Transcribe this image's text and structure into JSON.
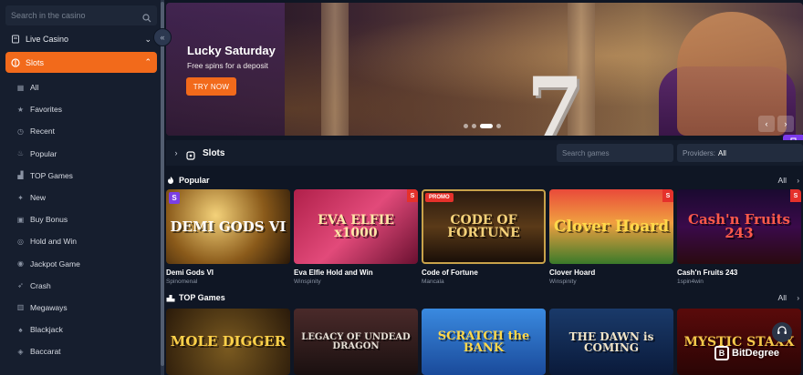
{
  "sidebar": {
    "search_placeholder": "Search in the casino",
    "categories": [
      {
        "label": "Live Casino",
        "icon": "live-casino-icon",
        "chevron": "⌄"
      },
      {
        "label": "Slots",
        "icon": "slots-icon",
        "chevron": "⌃",
        "active": true
      }
    ],
    "items": [
      {
        "label": "All",
        "icon": "grid-icon"
      },
      {
        "label": "Favorites",
        "icon": "star-icon"
      },
      {
        "label": "Recent",
        "icon": "clock-icon"
      },
      {
        "label": "Popular",
        "icon": "fire-icon"
      },
      {
        "label": "TOP Games",
        "icon": "podium-icon"
      },
      {
        "label": "New",
        "icon": "sparkle-icon"
      },
      {
        "label": "Buy Bonus",
        "icon": "cart-icon"
      },
      {
        "label": "Hold and Win",
        "icon": "coin-icon"
      },
      {
        "label": "Jackpot Game",
        "icon": "jackpot-icon"
      },
      {
        "label": "Crash",
        "icon": "rocket-icon"
      },
      {
        "label": "Megaways",
        "icon": "megaways-icon"
      },
      {
        "label": "Blackjack",
        "icon": "cards-icon"
      },
      {
        "label": "Baccarat",
        "icon": "chip-icon"
      }
    ],
    "collapse_glyph": "«"
  },
  "banner": {
    "title": "Lucky Saturday",
    "subtitle": "Free spins for a deposit",
    "cta": "TRY NOW",
    "prev_glyph": "‹",
    "next_glyph": "›"
  },
  "slots_bar": {
    "expand_glyph": "›",
    "label": "Slots",
    "search_placeholder": "Search games",
    "providers_label": "Providers:",
    "providers_value": "All"
  },
  "sections": {
    "popular": {
      "title": "Popular",
      "all": "All",
      "games": [
        {
          "name": "Demi Gods VI",
          "provider": "Spinomenal",
          "art": "DEMI GODS VI"
        },
        {
          "name": "Eva Elfie Hold and Win",
          "provider": "Winspinity",
          "art": "EVA ELFIE x1000"
        },
        {
          "name": "Code of Fortune",
          "provider": "Mancala",
          "art": "CODE OF FORTUNE",
          "badge": "PROMO"
        },
        {
          "name": "Clover Hoard",
          "provider": "Winspinity",
          "art": "Clover Hoard"
        },
        {
          "name": "Cash'n Fruits 243",
          "provider": "1spin4win",
          "art": "Cash'n Fruits 243"
        }
      ]
    },
    "top": {
      "title": "TOP Games",
      "all": "All",
      "games": [
        {
          "art": "MOLE DIGGER"
        },
        {
          "art": "LEGACY OF UNDEAD DRAGON"
        },
        {
          "art": "SCRATCH the BANK"
        },
        {
          "art": "THE DAWN is COMING"
        },
        {
          "art": "MYSTIC STAXX"
        }
      ]
    }
  },
  "watermark": {
    "text": "BitDegree",
    "logo": "B"
  },
  "colors": {
    "accent": "#f26a1b",
    "background": "#0f1624",
    "sidebar": "#161e2e",
    "trophy": "#7c3aed"
  }
}
